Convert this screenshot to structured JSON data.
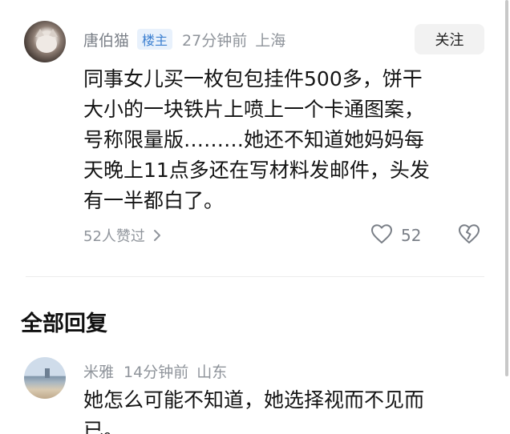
{
  "post": {
    "author": "唐伯猫",
    "badge": "楼主",
    "time": "27分钟前",
    "location": "上海",
    "follow_label": "关注",
    "body": "同事女儿买一枚包包挂件500多，饼干\n大小的一块铁片上喷上一个卡通图案，\n号称限量版………她还不知道她妈妈每\n天晚上11点多还在写材料发邮件，头发\n有一半都白了。",
    "likes_label": "52人赞过",
    "like_count": "52",
    "icons": {
      "likes_chevron": "chevron-right-icon",
      "like": "heart-outline-icon",
      "dislike": "broken-heart-icon"
    }
  },
  "replies": {
    "title": "全部回复",
    "items": [
      {
        "author": "米雅",
        "time": "14分钟前",
        "location": "山东",
        "body": "她怎么可能不知道，她选择视而不见而\n已。"
      }
    ]
  },
  "colors": {
    "accent_badge_text": "#3b7fd0",
    "accent_badge_bg": "#e8f1fc",
    "meta_gray": "#8f949b",
    "follow_bg": "#f2f2f2"
  }
}
